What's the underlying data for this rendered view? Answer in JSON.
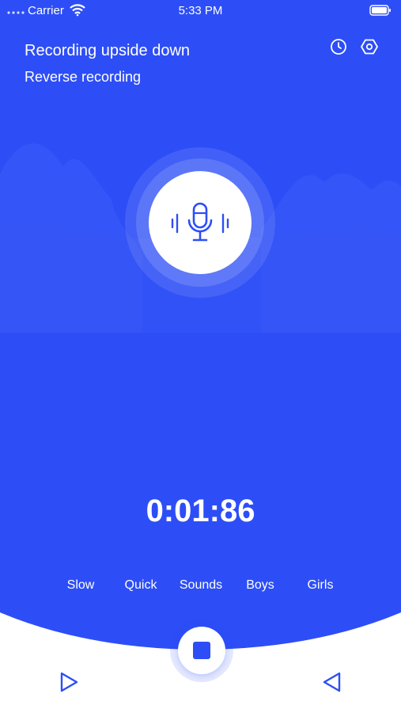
{
  "status_bar": {
    "carrier": "Carrier",
    "time": "5:33 PM"
  },
  "header": {
    "title": "Recording upside down",
    "subtitle": "Reverse recording",
    "history_icon": "clock-icon",
    "settings_icon": "settings-icon"
  },
  "recorder": {
    "timer": "0:01:86",
    "mic_icon": "microphone-icon"
  },
  "effects": [
    "Slow",
    "Quick",
    "Sounds",
    "Boys",
    "Girls"
  ],
  "controls": {
    "play_icon": "play-icon",
    "stop_icon": "stop-icon",
    "reverse_icon": "reverse-play-icon"
  },
  "colors": {
    "primary": "#2d4ef6",
    "background": "#ffffff",
    "text_light": "#ffffff"
  }
}
